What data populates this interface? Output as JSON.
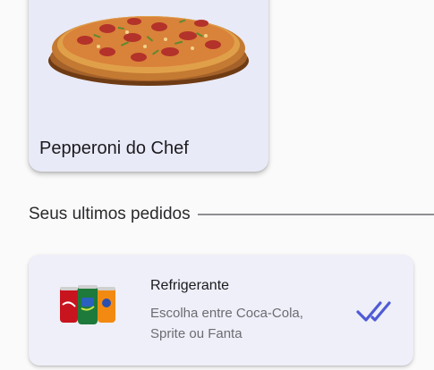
{
  "featured": {
    "title": "Pepperoni do Chef",
    "image_icon": "pizza-image"
  },
  "section": {
    "title": "Seus ultimos pedidos"
  },
  "orders": [
    {
      "title": "Refrigerante",
      "description": "Escolha entre Coca-Cola, Sprite ou Fanta",
      "image_icon": "soda-cans-image",
      "status_icon": "double-check-icon"
    }
  ],
  "colors": {
    "card_background": "#e9eaf7",
    "order_card_background": "#eeeff8",
    "check_color": "#4f5bd5",
    "divider": "#8e8e93"
  }
}
